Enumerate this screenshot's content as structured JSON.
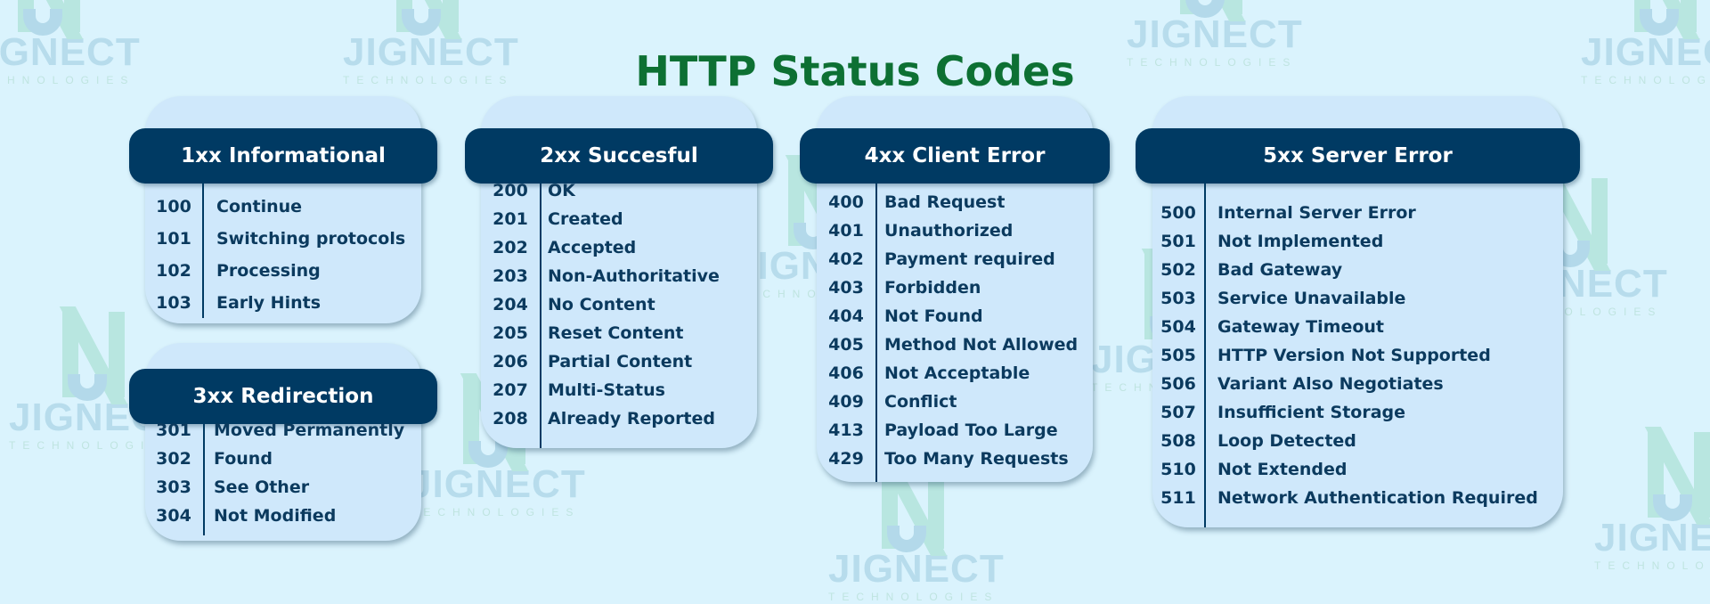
{
  "title": "HTTP Status Codes",
  "watermark": {
    "word": "JIGNECT",
    "sub": "TECHNOLOGIES"
  },
  "groups": [
    {
      "id": "1xx",
      "header": "1xx Informational",
      "rows": [
        {
          "code": "100",
          "label": "Continue"
        },
        {
          "code": "101",
          "label": "Switching protocols"
        },
        {
          "code": "102",
          "label": "Processing"
        },
        {
          "code": "103",
          "label": "Early Hints"
        }
      ]
    },
    {
      "id": "2xx",
      "header": "2xx Succesful",
      "rows": [
        {
          "code": "200",
          "label": "OK"
        },
        {
          "code": "201",
          "label": "Created"
        },
        {
          "code": "202",
          "label": "Accepted"
        },
        {
          "code": "203",
          "label": "Non-Authoritative"
        },
        {
          "code": "204",
          "label": "No Content"
        },
        {
          "code": "205",
          "label": "Reset Content"
        },
        {
          "code": "206",
          "label": "Partial Content"
        },
        {
          "code": "207",
          "label": "Multi-Status"
        },
        {
          "code": "208",
          "label": "Already Reported"
        }
      ]
    },
    {
      "id": "3xx",
      "header": "3xx Redirection",
      "rows": [
        {
          "code": "301",
          "label": "Moved Permanently"
        },
        {
          "code": "302",
          "label": "Found"
        },
        {
          "code": "303",
          "label": "See Other"
        },
        {
          "code": "304",
          "label": "Not Modified"
        }
      ]
    },
    {
      "id": "4xx",
      "header": "4xx Client Error",
      "rows": [
        {
          "code": "400",
          "label": "Bad Request"
        },
        {
          "code": "401",
          "label": "Unauthorized"
        },
        {
          "code": "402",
          "label": "Payment required"
        },
        {
          "code": "403",
          "label": "Forbidden"
        },
        {
          "code": "404",
          "label": "Not Found"
        },
        {
          "code": "405",
          "label": "Method Not Allowed"
        },
        {
          "code": "406",
          "label": "Not Acceptable"
        },
        {
          "code": "409",
          "label": "Conflict"
        },
        {
          "code": "413",
          "label": "Payload Too Large"
        },
        {
          "code": "429",
          "label": "Too Many Requests"
        }
      ]
    },
    {
      "id": "5xx",
      "header": "5xx Server Error",
      "rows": [
        {
          "code": "500",
          "label": "Internal Server Error"
        },
        {
          "code": "501",
          "label": "Not Implemented"
        },
        {
          "code": "502",
          "label": "Bad Gateway"
        },
        {
          "code": "503",
          "label": "Service Unavailable"
        },
        {
          "code": "504",
          "label": "Gateway Timeout"
        },
        {
          "code": "505",
          "label": "HTTP Version Not Supported"
        },
        {
          "code": "506",
          "label": "Variant Also Negotiates"
        },
        {
          "code": "507",
          "label": "Insufficient Storage"
        },
        {
          "code": "508",
          "label": "Loop Detected"
        },
        {
          "code": "510",
          "label": "Not Extended"
        },
        {
          "code": "511",
          "label": "Network Authentication Required"
        }
      ]
    }
  ],
  "colors": {
    "background": "#daf3fd",
    "title": "#0d7033",
    "header_band": "#003a63",
    "card": "#cfe8fb",
    "text": "#0b3a5e"
  }
}
